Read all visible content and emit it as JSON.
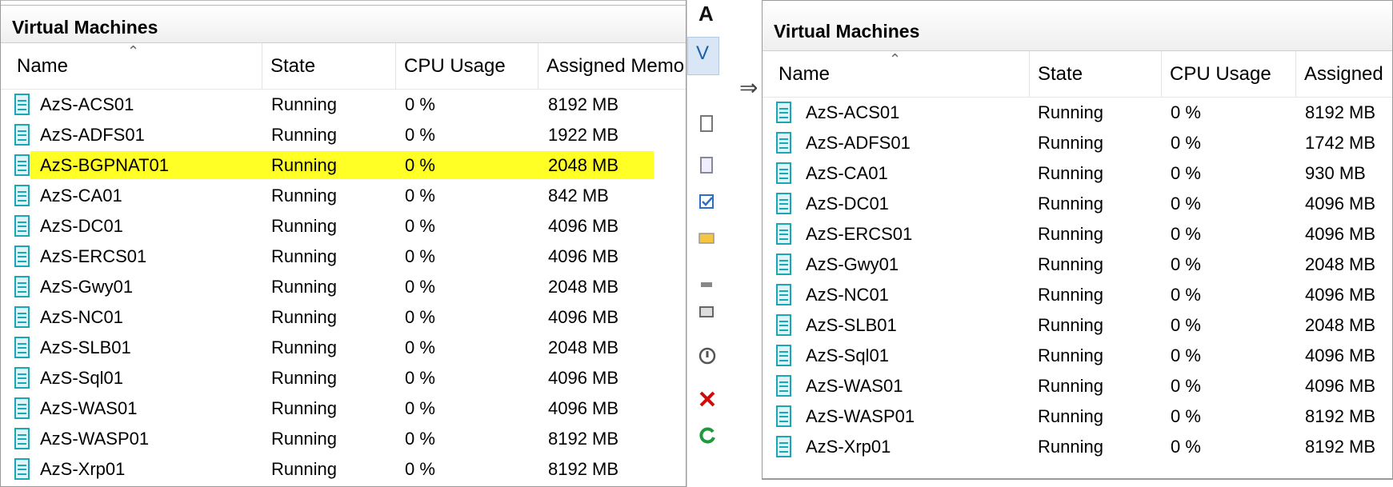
{
  "left": {
    "title": "Virtual Machines",
    "columns": [
      "Name",
      "State",
      "CPU Usage",
      "Assigned Memo"
    ],
    "rows": [
      {
        "name": "AzS-ACS01",
        "state": "Running",
        "cpu": "0 %",
        "memory": "8192 MB"
      },
      {
        "name": "AzS-ADFS01",
        "state": "Running",
        "cpu": "0 %",
        "memory": "1922 MB"
      },
      {
        "name": "AzS-BGPNAT01",
        "state": "Running",
        "cpu": "0 %",
        "memory": "2048 MB"
      },
      {
        "name": "AzS-CA01",
        "state": "Running",
        "cpu": "0 %",
        "memory": "842 MB"
      },
      {
        "name": "AzS-DC01",
        "state": "Running",
        "cpu": "0 %",
        "memory": "4096 MB"
      },
      {
        "name": "AzS-ERCS01",
        "state": "Running",
        "cpu": "0 %",
        "memory": "4096 MB"
      },
      {
        "name": "AzS-Gwy01",
        "state": "Running",
        "cpu": "0 %",
        "memory": "2048 MB"
      },
      {
        "name": "AzS-NC01",
        "state": "Running",
        "cpu": "0 %",
        "memory": "4096 MB"
      },
      {
        "name": "AzS-SLB01",
        "state": "Running",
        "cpu": "0 %",
        "memory": "2048 MB"
      },
      {
        "name": "AzS-Sql01",
        "state": "Running",
        "cpu": "0 %",
        "memory": "4096 MB"
      },
      {
        "name": "AzS-WAS01",
        "state": "Running",
        "cpu": "0 %",
        "memory": "4096 MB"
      },
      {
        "name": "AzS-WASP01",
        "state": "Running",
        "cpu": "0 %",
        "memory": "8192 MB"
      },
      {
        "name": "AzS-Xrp01",
        "state": "Running",
        "cpu": "0 %",
        "memory": "8192 MB"
      }
    ],
    "highlight_color": "#ffff00"
  },
  "middle": {
    "title_fragment": "A",
    "tab_fragment": "V"
  },
  "right": {
    "title": "Virtual Machines",
    "columns": [
      "Name",
      "State",
      "CPU Usage",
      "Assigned"
    ],
    "rows": [
      {
        "name": "AzS-ACS01",
        "state": "Running",
        "cpu": "0 %",
        "memory": "8192 MB"
      },
      {
        "name": "AzS-ADFS01",
        "state": "Running",
        "cpu": "0 %",
        "memory": "1742 MB"
      },
      {
        "name": "AzS-CA01",
        "state": "Running",
        "cpu": "0 %",
        "memory": "930 MB"
      },
      {
        "name": "AzS-DC01",
        "state": "Running",
        "cpu": "0 %",
        "memory": "4096 MB"
      },
      {
        "name": "AzS-ERCS01",
        "state": "Running",
        "cpu": "0 %",
        "memory": "4096 MB"
      },
      {
        "name": "AzS-Gwy01",
        "state": "Running",
        "cpu": "0 %",
        "memory": "2048 MB"
      },
      {
        "name": "AzS-NC01",
        "state": "Running",
        "cpu": "0 %",
        "memory": "4096 MB"
      },
      {
        "name": "AzS-SLB01",
        "state": "Running",
        "cpu": "0 %",
        "memory": "2048 MB"
      },
      {
        "name": "AzS-Sql01",
        "state": "Running",
        "cpu": "0 %",
        "memory": "4096 MB"
      },
      {
        "name": "AzS-WAS01",
        "state": "Running",
        "cpu": "0 %",
        "memory": "4096 MB"
      },
      {
        "name": "AzS-WASP01",
        "state": "Running",
        "cpu": "0 %",
        "memory": "8192 MB"
      },
      {
        "name": "AzS-Xrp01",
        "state": "Running",
        "cpu": "0 %",
        "memory": "8192 MB"
      }
    ]
  },
  "icons": {
    "vm": "virtual-machine-icon",
    "sort": "sort-ascending-icon",
    "cursor": "resize-arrow-icon"
  },
  "colors": {
    "vm_icon": "#1ba6b7",
    "highlight": "#ffff00"
  }
}
